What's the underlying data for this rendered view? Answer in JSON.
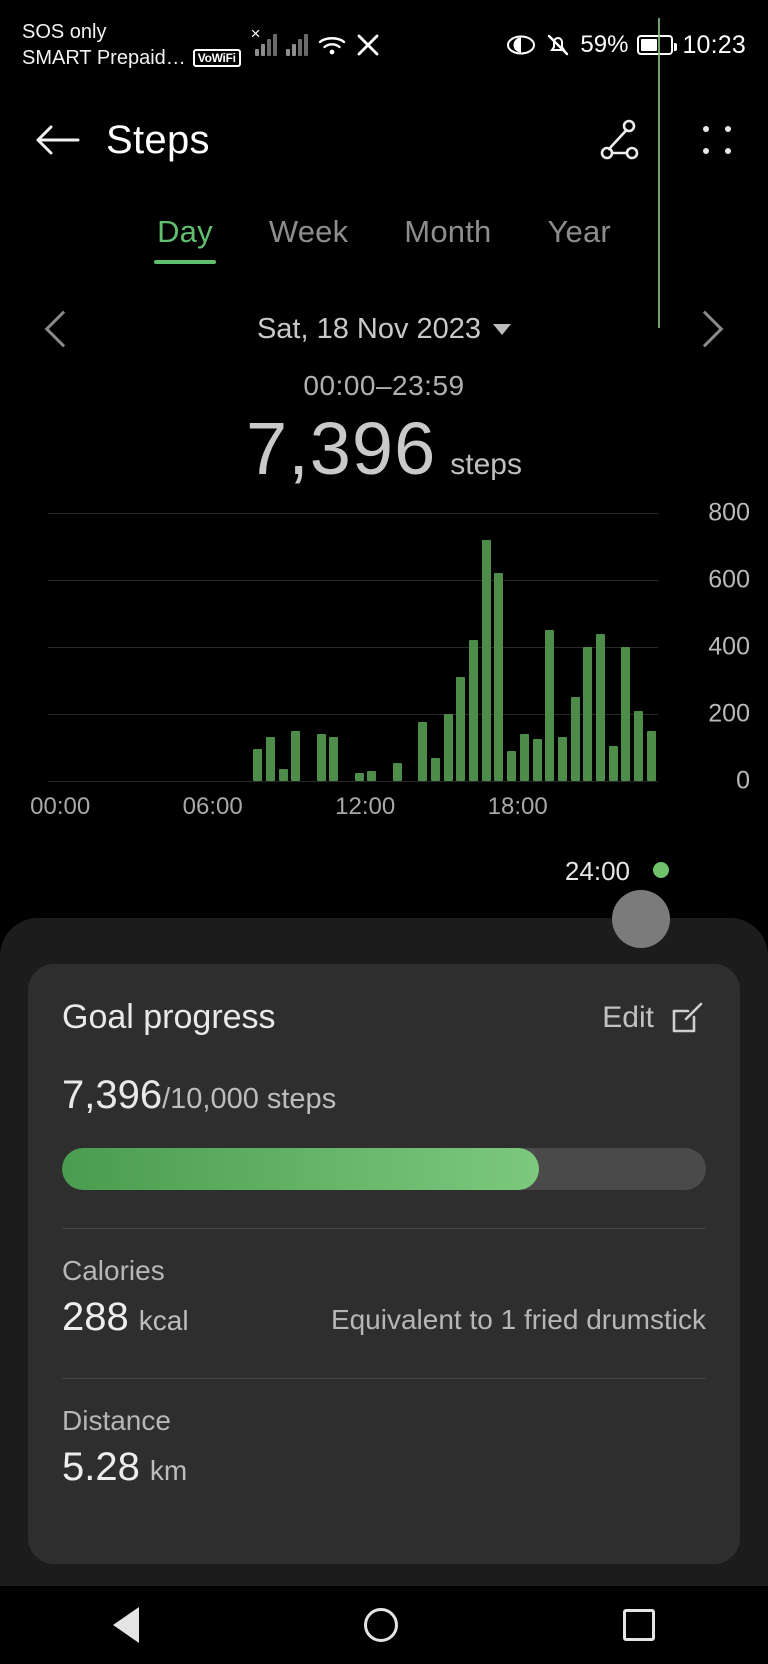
{
  "status_bar": {
    "carrier_line1": "SOS only",
    "carrier_line2": "SMART Prepaid…",
    "vowifi_badge": "VoWiFi",
    "battery_percent": "59%",
    "clock": "10:23",
    "icons": [
      "signal-bars-icon",
      "signal-bars-icon",
      "wifi-icon",
      "x-app-icon",
      "eye-comfort-icon",
      "mute-bell-icon",
      "battery-icon"
    ]
  },
  "header": {
    "title": "Steps",
    "back_icon": "back-arrow-icon",
    "share_icon": "share-nodes-icon",
    "menu_icon": "more-options-icon"
  },
  "tabs": [
    {
      "label": "Day",
      "active": true
    },
    {
      "label": "Week",
      "active": false
    },
    {
      "label": "Month",
      "active": false
    },
    {
      "label": "Year",
      "active": false
    }
  ],
  "date_nav": {
    "prev_icon": "chevron-left-icon",
    "next_icon": "chevron-right-icon",
    "date": "Sat, 18 Nov 2023",
    "caret_icon": "caret-down-icon"
  },
  "summary": {
    "time_range": "00:00–23:59",
    "count": "7,396",
    "unit": "steps"
  },
  "chart_data": {
    "type": "bar",
    "title": "Steps per interval",
    "xlabel": "",
    "ylabel": "",
    "ylim": [
      0,
      800
    ],
    "yticks": [
      "800",
      "600",
      "400",
      "200",
      "0"
    ],
    "xticks": [
      "00:00",
      "06:00",
      "12:00",
      "18:00"
    ],
    "xtick_positions_pct": [
      2,
      27,
      52,
      77
    ],
    "grid": true,
    "bar_color": "#4e8c4a",
    "scrubber": {
      "label": "24:00",
      "color": "#6fc16a"
    },
    "categories": [
      "00:00",
      "00:30",
      "01:00",
      "01:30",
      "02:00",
      "02:30",
      "03:00",
      "03:30",
      "04:00",
      "04:30",
      "05:00",
      "05:30",
      "06:00",
      "06:30",
      "07:00",
      "07:30",
      "08:00",
      "08:30",
      "09:00",
      "09:30",
      "10:00",
      "10:30",
      "11:00",
      "11:30",
      "12:00",
      "12:30",
      "13:00",
      "13:30",
      "14:00",
      "14:30",
      "15:00",
      "15:30",
      "16:00",
      "16:30",
      "17:00",
      "17:30",
      "18:00",
      "18:30",
      "19:00",
      "19:30",
      "20:00",
      "20:30",
      "21:00",
      "21:30",
      "22:00",
      "22:30",
      "23:00",
      "23:30"
    ],
    "values": [
      0,
      0,
      0,
      0,
      0,
      0,
      0,
      0,
      0,
      0,
      0,
      0,
      0,
      0,
      0,
      0,
      95,
      130,
      35,
      150,
      0,
      140,
      130,
      0,
      25,
      30,
      0,
      55,
      0,
      175,
      70,
      200,
      310,
      420,
      720,
      620,
      90,
      140,
      125,
      450,
      130,
      250,
      400,
      440,
      105,
      400,
      210,
      150
    ]
  },
  "sheet": {
    "knob_icon": "drag-handle-knob",
    "goal_card": {
      "title": "Goal progress",
      "edit_label": "Edit",
      "edit_icon": "edit-pencil-icon",
      "current": "7,396",
      "total": "/10,000",
      "unit": "steps",
      "progress_percent": 74,
      "progress_color_start": "#4a9c4f",
      "progress_color_end": "#7cc97e"
    },
    "stats": [
      {
        "label": "Calories",
        "value": "288",
        "unit": "kcal",
        "note": "Equivalent to 1 fried drumstick"
      },
      {
        "label": "Distance",
        "value": "5.28",
        "unit": "km",
        "note": ""
      }
    ]
  },
  "nav_bar": {
    "back_icon": "nav-back-triangle-icon",
    "home_icon": "nav-home-circle-icon",
    "recent_icon": "nav-recents-square-icon"
  }
}
